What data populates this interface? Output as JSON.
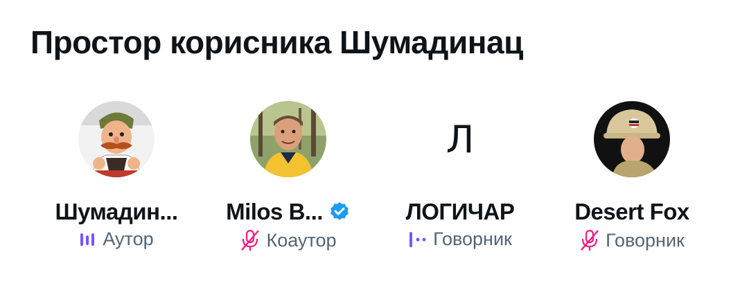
{
  "space": {
    "title": "Простор корисника Шумадинац"
  },
  "participants": [
    {
      "name": "Шумадин...",
      "role": "Аутор",
      "role_icon": "speaking-bars-icon",
      "verified": false,
      "avatar": "illustration-avatar"
    },
    {
      "name": "Milos B...",
      "role": "Коаутор",
      "role_icon": "muted-mic-icon",
      "verified": true,
      "avatar": "photo-avatar"
    },
    {
      "name": "ЛОГИЧАР",
      "role": "Говорник",
      "role_icon": "speaking-dots-icon",
      "verified": false,
      "avatar": "letter-avatar",
      "avatar_letter": "Л"
    },
    {
      "name": "Desert Fox",
      "role": "Говорник",
      "role_icon": "muted-mic-icon",
      "verified": false,
      "avatar": "photo-avatar"
    }
  ],
  "colors": {
    "speaking_accent": "#7856ff",
    "muted_accent": "#f91880",
    "verified_badge": "#1d9bf0",
    "secondary_text": "#536471"
  }
}
